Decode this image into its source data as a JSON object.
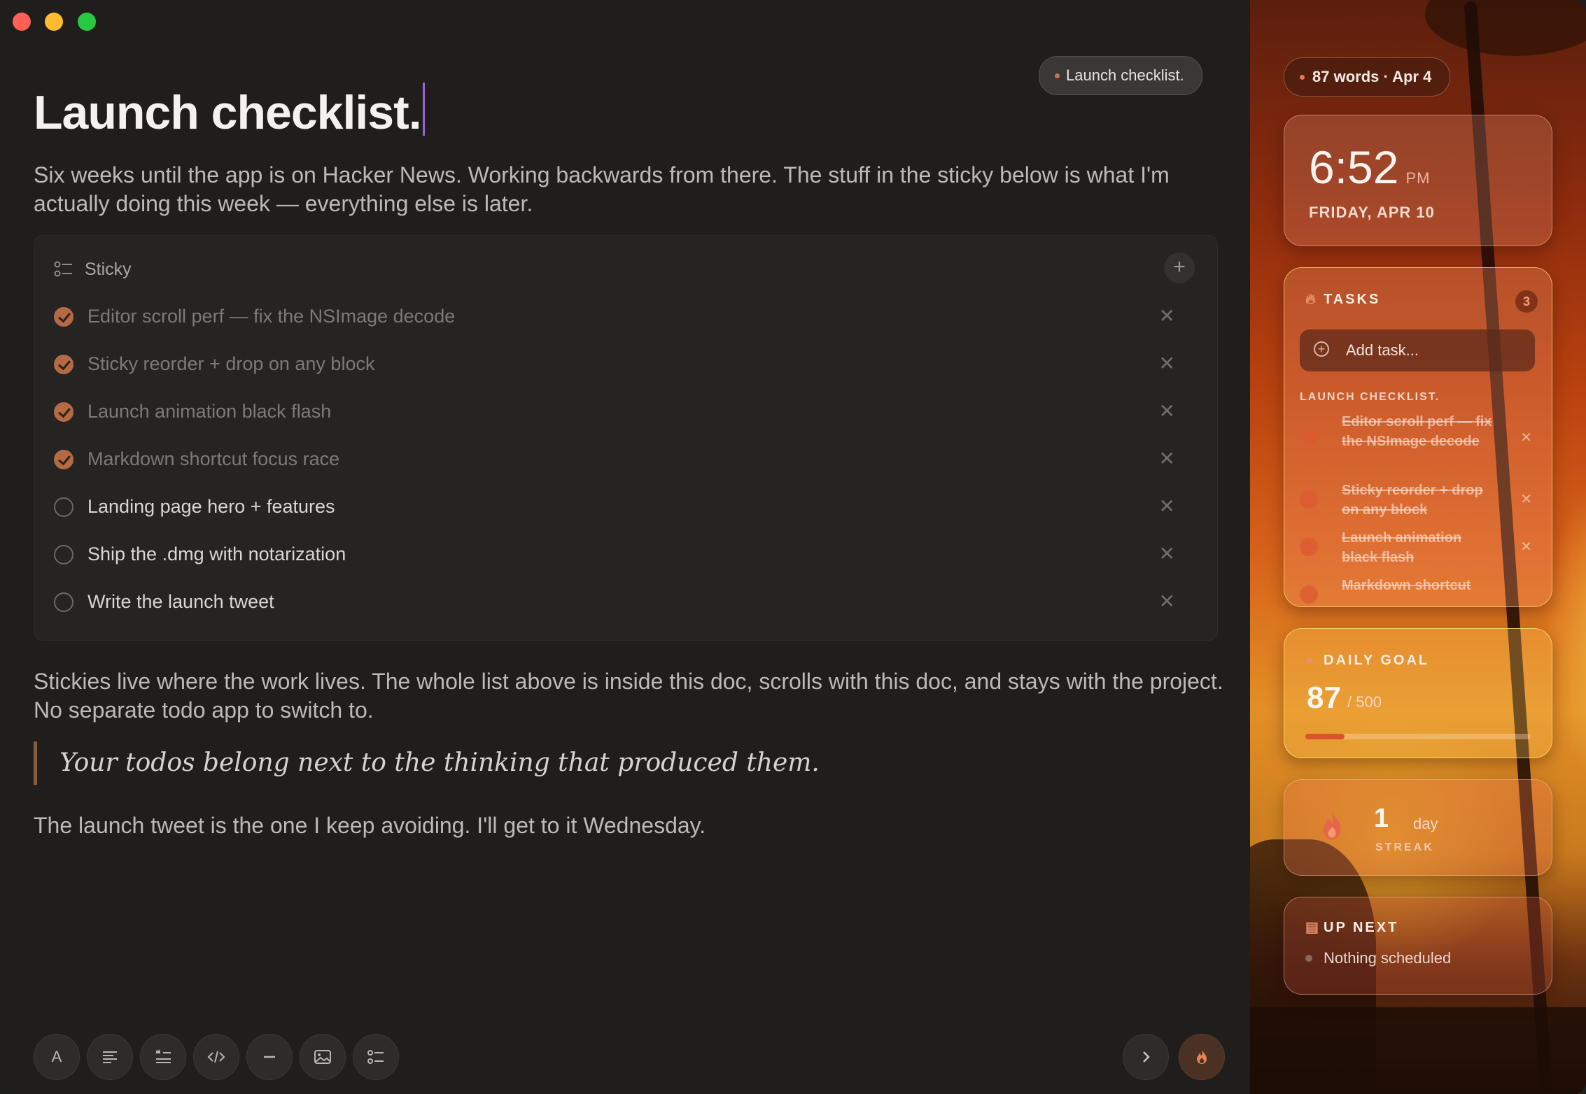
{
  "document": {
    "title": "Launch checklist.",
    "context_pill": "Launch checklist.",
    "intro": "Six weeks until the app is on Hacker News. Working backwards from there. The stuff in the sticky below is what I'm actually doing this week — everything else is later.",
    "sticky": {
      "label": "Sticky",
      "items": [
        {
          "text": "Editor scroll perf — fix the NSImage decode",
          "done": true
        },
        {
          "text": "Sticky reorder + drop on any block",
          "done": true
        },
        {
          "text": "Launch animation black flash",
          "done": true
        },
        {
          "text": "Markdown shortcut focus race",
          "done": true
        },
        {
          "text": "Landing page hero + features",
          "done": false
        },
        {
          "text": "Ship the .dmg with notarization",
          "done": false
        },
        {
          "text": "Write the launch tweet",
          "done": false
        }
      ]
    },
    "body": "Stickies live where the work lives. The whole list above is inside this doc, scrolls with this doc, and stays with the project. No separate todo app to switch to.",
    "quote": "Your todos belong next to the thinking that produced them.",
    "closing": "The launch tweet is the one I keep avoiding. I'll get to it Wednesday."
  },
  "toolbar": {
    "text_style_label": "A",
    "icons": [
      "paragraph-icon",
      "quote-icon",
      "code-icon",
      "divider-icon",
      "image-icon",
      "checklist-icon"
    ],
    "right_icons": [
      "chevron-right-icon",
      "flame-icon"
    ]
  },
  "sidebar": {
    "stats_pill": "87 words · Apr 4",
    "clock": {
      "time": "6:52",
      "ampm": "PM",
      "date": "FRIDAY, APR 10"
    },
    "tasks": {
      "heading": "TASKS",
      "count": "3",
      "add_placeholder": "Add task...",
      "group": "LAUNCH CHECKLIST.",
      "items": [
        "Editor scroll perf — fix the NSImage decode",
        "Sticky reorder + drop on any block",
        "Launch animation black flash",
        "Markdown shortcut"
      ]
    },
    "daily_goal": {
      "heading": "DAILY GOAL",
      "current": "87",
      "target": "/ 500",
      "progress": 0.174
    },
    "streak": {
      "value": "1",
      "unit": "day",
      "label": "STREAK"
    },
    "up_next": {
      "heading": "UP NEXT",
      "empty": "Nothing scheduled"
    }
  },
  "colors": {
    "accent": "#b46a43",
    "caret": "#a05fd6",
    "quote_bar": "#8a5a3c"
  }
}
